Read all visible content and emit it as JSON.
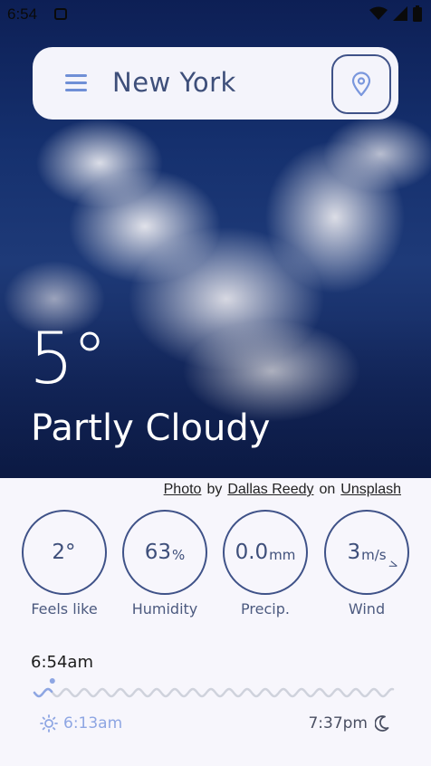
{
  "status_bar": {
    "time": "6:54"
  },
  "search": {
    "city": "New York"
  },
  "weather": {
    "temperature": "5°",
    "condition": "Partly Cloudy"
  },
  "credit": {
    "photo_label": "Photo",
    "by": "by",
    "author": "Dallas Reedy",
    "on": "on",
    "source": "Unsplash"
  },
  "stats": [
    {
      "value": "2°",
      "unit": "",
      "label": "Feels like"
    },
    {
      "value": "63",
      "unit": "%",
      "label": "Humidity"
    },
    {
      "value": "0.0",
      "unit": "mm",
      "label": "Precip."
    },
    {
      "value": "3",
      "unit": "m/s",
      "label": "Wind"
    }
  ],
  "sun": {
    "current_time": "6:54am",
    "sunrise": "6:13am",
    "sunset": "7:37pm",
    "day_progress": 0.05
  },
  "colors": {
    "accent": "#3f5288",
    "accent_light": "#8ea6e3",
    "background": "#f7f6fc"
  },
  "icons": {
    "menu": "menu-icon",
    "location": "location-pin-icon",
    "sun": "sun-icon",
    "moon": "moon-icon",
    "wind_direction": "wind-direction-icon"
  }
}
